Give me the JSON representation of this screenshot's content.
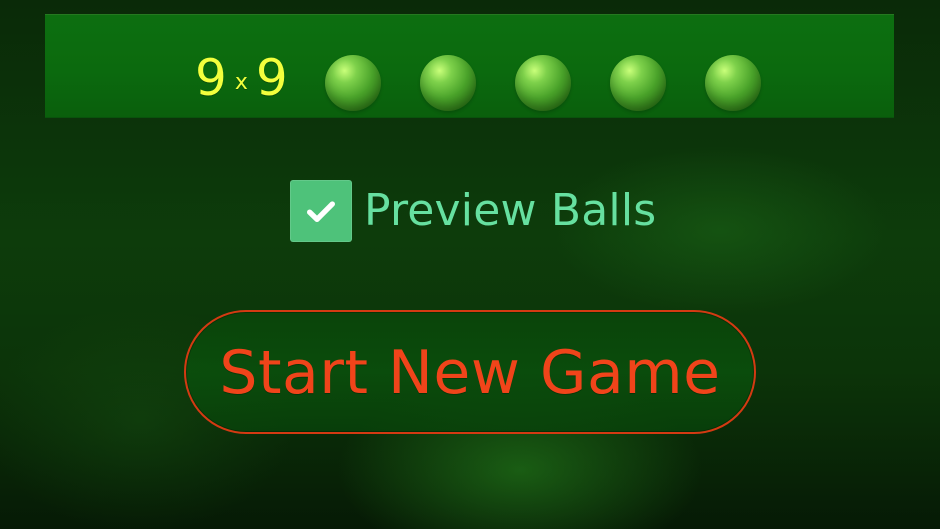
{
  "board": {
    "size_a": "9",
    "size_x": "x",
    "size_b": "9",
    "balls_count": 5,
    "ball_icon": "green-ball-icon"
  },
  "options": {
    "preview_balls": {
      "label": "Preview Balls",
      "checked": true,
      "icon": "checkmark-icon"
    }
  },
  "actions": {
    "start_label": "Start New Game"
  },
  "colors": {
    "bar_green": "#0B6A0E",
    "size_yellow": "#F2FF3D",
    "check_green": "#4EC27A",
    "label_mint": "#66E0A0",
    "button_red": "#F0441A",
    "button_border": "#D43A12"
  }
}
